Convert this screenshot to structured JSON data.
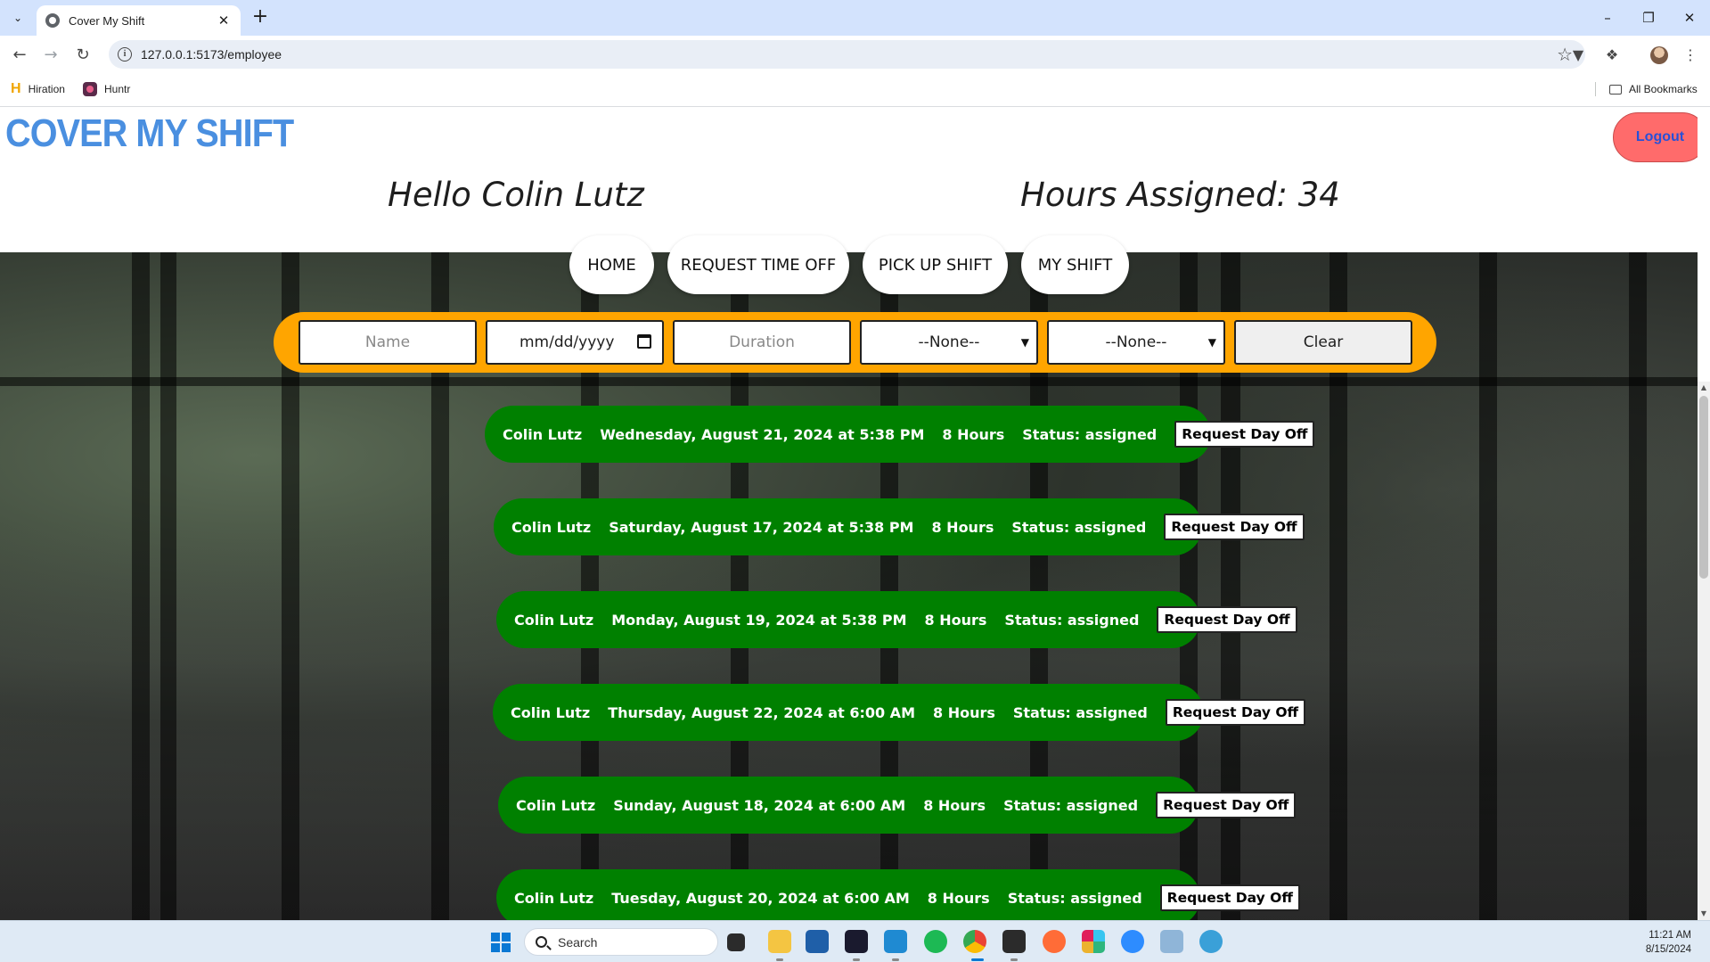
{
  "browser": {
    "tab_title": "Cover My Shift",
    "url": "127.0.0.1:5173/employee",
    "bookmarks": [
      {
        "label": "Hiration",
        "icon": "hiration-icon"
      },
      {
        "label": "Huntr",
        "icon": "huntr-icon"
      }
    ],
    "all_bookmarks_label": "All Bookmarks"
  },
  "app": {
    "logo": "COVER MY SHIFT",
    "logout_label": "Logout",
    "greeting": "Hello Colin Lutz",
    "hours_assigned": "Hours Assigned: 34",
    "nav": [
      "HOME",
      "REQUEST TIME OFF",
      "PICK UP SHIFT",
      "MY SHIFT"
    ],
    "filters": {
      "name_placeholder": "Name",
      "date_placeholder": "mm/dd/yyyy",
      "duration_placeholder": "Duration",
      "select1_value": "--None--",
      "select2_value": "--None--",
      "clear_label": "Clear"
    },
    "request_button_label": "Request Day Off",
    "shifts": [
      {
        "name": "Colin Lutz",
        "date": "Wednesday, August 21, 2024 at 5:38 PM",
        "duration": "8 Hours",
        "status": "Status: assigned"
      },
      {
        "name": "Colin Lutz",
        "date": "Saturday, August 17, 2024 at 5:38 PM",
        "duration": "8 Hours",
        "status": "Status: assigned"
      },
      {
        "name": "Colin Lutz",
        "date": "Monday, August 19, 2024 at 5:38 PM",
        "duration": "8 Hours",
        "status": "Status: assigned"
      },
      {
        "name": "Colin Lutz",
        "date": "Thursday, August 22, 2024 at 6:00 AM",
        "duration": "8 Hours",
        "status": "Status: assigned"
      },
      {
        "name": "Colin Lutz",
        "date": "Sunday, August 18, 2024 at 6:00 AM",
        "duration": "8 Hours",
        "status": "Status: assigned"
      },
      {
        "name": "Colin Lutz",
        "date": "Tuesday, August 20, 2024 at 6:00 AM",
        "duration": "8 Hours",
        "status": "Status: assigned"
      }
    ]
  },
  "taskbar": {
    "search_placeholder": "Search",
    "time": "11:21 AM",
    "date": "8/15/2024"
  },
  "colors": {
    "logo": "#4a8fe0",
    "logout_bg": "#ff6b6b",
    "filter_bar": "#ffa500",
    "shift_row": "#008000"
  }
}
